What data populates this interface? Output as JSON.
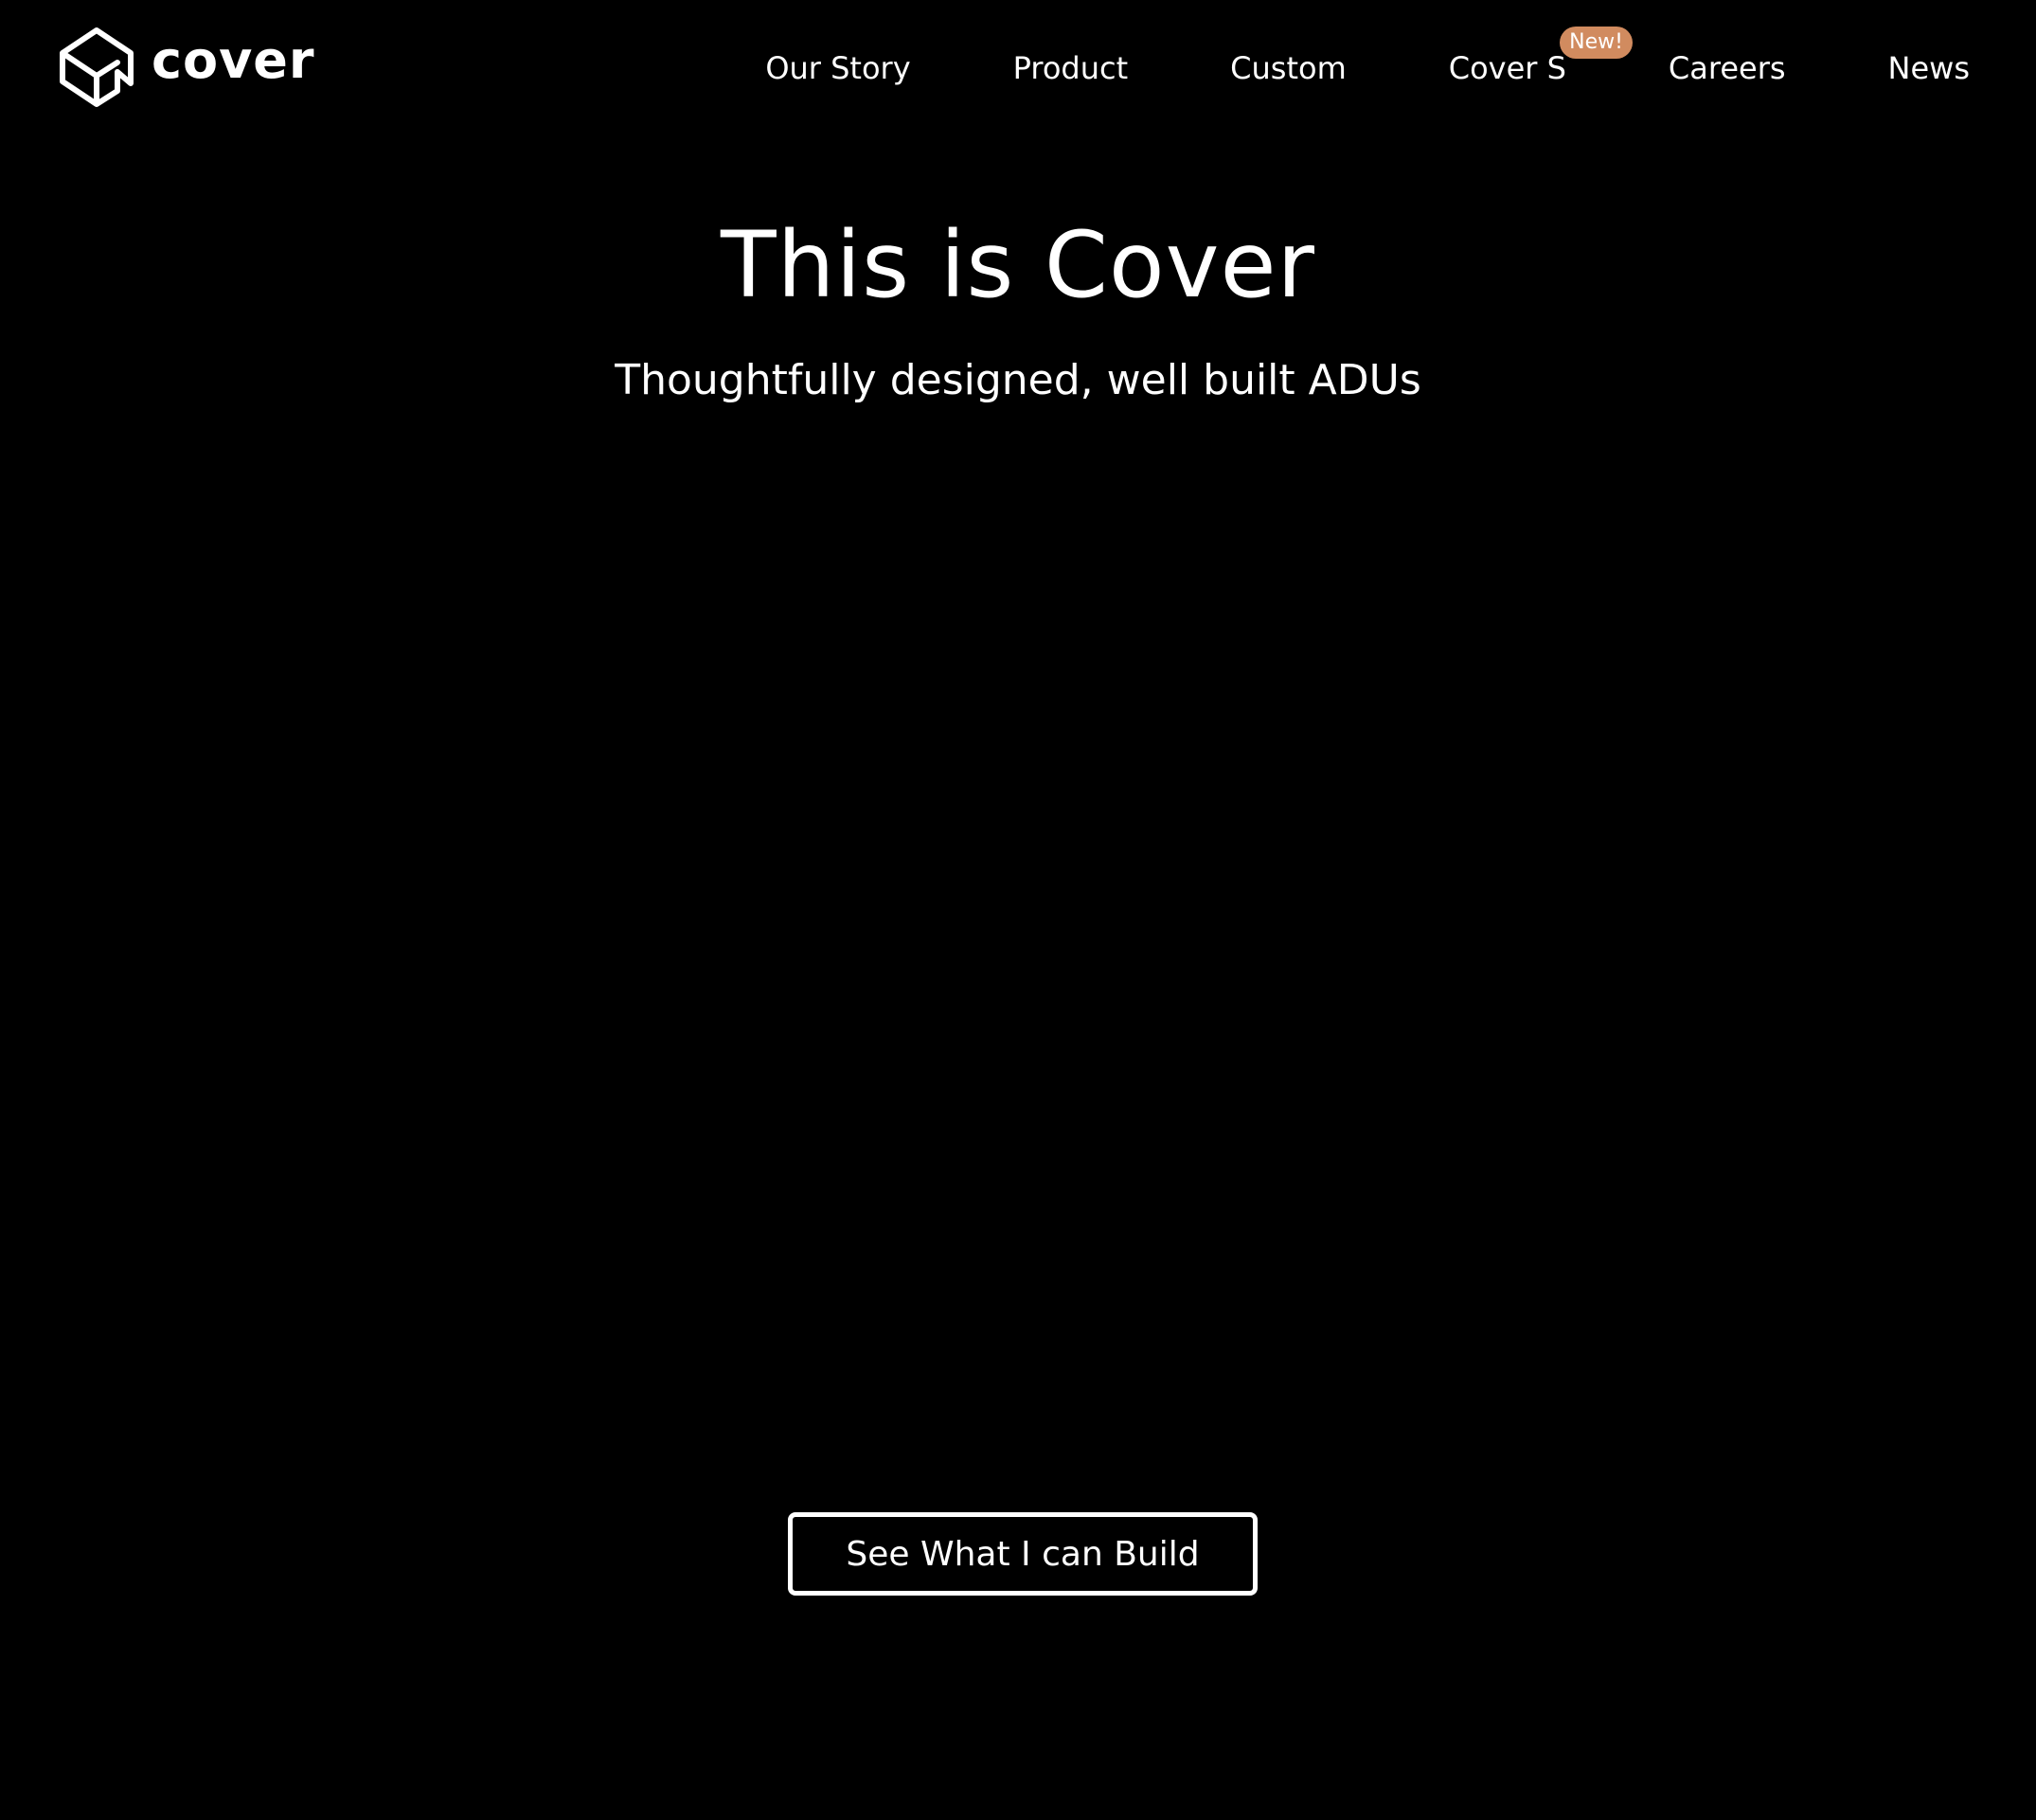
{
  "brand": {
    "name": "cover",
    "logo_icon": "house-cube-icon"
  },
  "nav": {
    "items": [
      {
        "label": "Our Story"
      },
      {
        "label": "Product"
      },
      {
        "label": "Custom"
      },
      {
        "label": "Cover S",
        "badge": "New!"
      },
      {
        "label": "Careers"
      },
      {
        "label": "News"
      }
    ]
  },
  "hero": {
    "title": "This is Cover",
    "subtitle": "Thoughtfully designed, well built ADUs",
    "cta_label": "See What I can Build"
  },
  "colors": {
    "background": "#000000",
    "text": "#ffffff",
    "badge": "#d18b5f"
  }
}
